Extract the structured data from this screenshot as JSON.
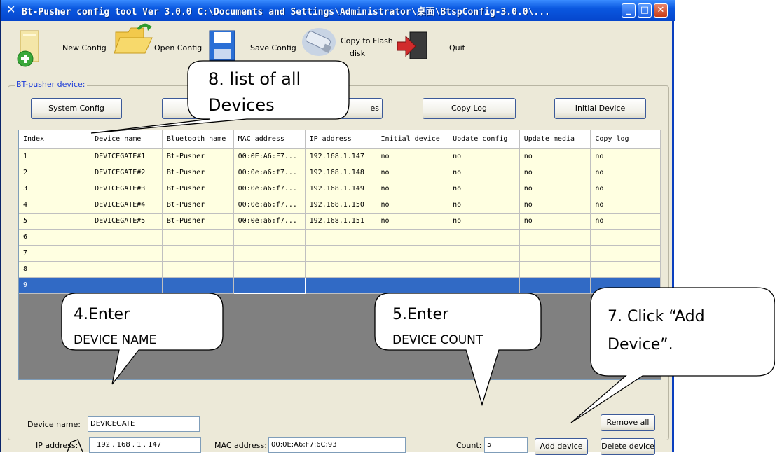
{
  "window": {
    "title": "Bt-Pusher config tool Ver 3.0.0    C:\\Documents and Settings\\Administrator\\桌面\\BtspConfig-3.0.0\\...",
    "app_icon": "tools-icon",
    "minimize_icon": "minimize-icon",
    "maximize_icon": "maximize-icon",
    "close_icon": "close-icon"
  },
  "toolbar": {
    "new_config": "New Config",
    "open_config": "Open Config",
    "save_config": "Save Config",
    "copy_flash_line1": "Copy to Flash",
    "copy_flash_line2": "disk",
    "quit": "Quit"
  },
  "device_group": {
    "title": "BT-pusher device:",
    "buttons": {
      "system_config": "System Config",
      "update_media": "es",
      "copy_log": "Copy Log",
      "initial_device": "Initial Device"
    }
  },
  "table": {
    "columns": [
      "Index",
      "Device name",
      "Bluetooth name",
      "MAC address",
      "IP address",
      "Initial device",
      "Update config",
      "Update media",
      "Copy log"
    ],
    "rows": [
      [
        "1",
        "DEVICEGATE#1",
        "Bt-Pusher",
        "00:0E:A6:F7...",
        "192.168.1.147",
        "no",
        "no",
        "no",
        "no"
      ],
      [
        "2",
        "DEVICEGATE#2",
        "Bt-Pusher",
        "00:0e:a6:f7...",
        "192.168.1.148",
        "no",
        "no",
        "no",
        "no"
      ],
      [
        "3",
        "DEVICEGATE#3",
        "Bt-Pusher",
        "00:0e:a6:f7...",
        "192.168.1.149",
        "no",
        "no",
        "no",
        "no"
      ],
      [
        "4",
        "DEVICEGATE#4",
        "Bt-Pusher",
        "00:0e:a6:f7...",
        "192.168.1.150",
        "no",
        "no",
        "no",
        "no"
      ],
      [
        "5",
        "DEVICEGATE#5",
        "Bt-Pusher",
        "00:0e:a6:f7...",
        "192.168.1.151",
        "no",
        "no",
        "no",
        "no"
      ],
      [
        "6",
        "",
        "",
        "",
        "",
        "",
        "",
        "",
        ""
      ],
      [
        "7",
        "",
        "",
        "",
        "",
        "",
        "",
        "",
        ""
      ],
      [
        "8",
        "",
        "",
        "",
        "",
        "",
        "",
        "",
        ""
      ],
      [
        "9",
        "",
        "",
        "",
        "",
        "",
        "",
        "",
        ""
      ]
    ],
    "selected_row_index": 9
  },
  "form": {
    "device_name_label": "Device name:",
    "device_name_value": "DEVICEGATE",
    "ip_label": "IP address:",
    "ip_value": "192 . 168 . 1 . 147",
    "mac_label": "MAC address:",
    "mac_value": "00:0E:A6:F7:6C:93",
    "count_label": "Count:",
    "count_value": "5",
    "remove_all": "Remove all",
    "add_device": "Add device",
    "delete_device": "Delete device"
  },
  "callouts": {
    "c8_line1": "8. list of all",
    "c8_line2": "Devices",
    "c4_line1": "4.Enter",
    "c4_line2": "DEVICE NAME",
    "c5_line1": "5.Enter",
    "c5_line2": "DEVICE COUNT",
    "c7_line1": "7. Click “Add",
    "c7_line2": "Device”."
  }
}
